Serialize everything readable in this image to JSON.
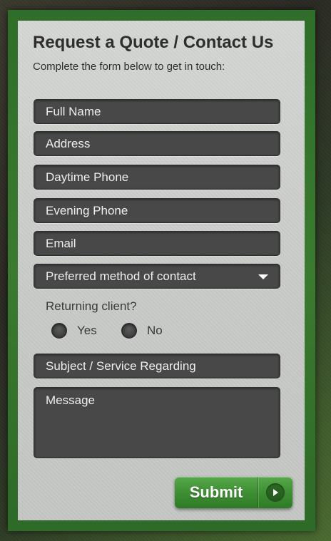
{
  "header": {
    "title": "Request a Quote / Contact Us",
    "subtitle": "Complete the form below to get in touch:"
  },
  "form": {
    "fields": {
      "full_name": "Full Name",
      "address": "Address",
      "daytime_phone": "Daytime Phone",
      "evening_phone": "Evening Phone",
      "email": "Email",
      "subject": "Subject / Service Regarding",
      "message": "Message"
    },
    "contact_method": {
      "placeholder": "Preferred method of contact"
    },
    "returning_client": {
      "label": "Returning client?",
      "options": [
        "Yes",
        "No"
      ]
    },
    "submit_label": "Submit"
  },
  "icons": {
    "dropdown": "chevron-down-icon",
    "submit": "arrow-right-icon",
    "radio": "radio-circle-icon"
  },
  "colors": {
    "frame": "#3b7a30",
    "panel": "#cbcdca",
    "field_background": "#484848",
    "field_text": "#eeeeee",
    "heading_text": "#2e2e2e",
    "submit_button": "#3e8f33"
  }
}
